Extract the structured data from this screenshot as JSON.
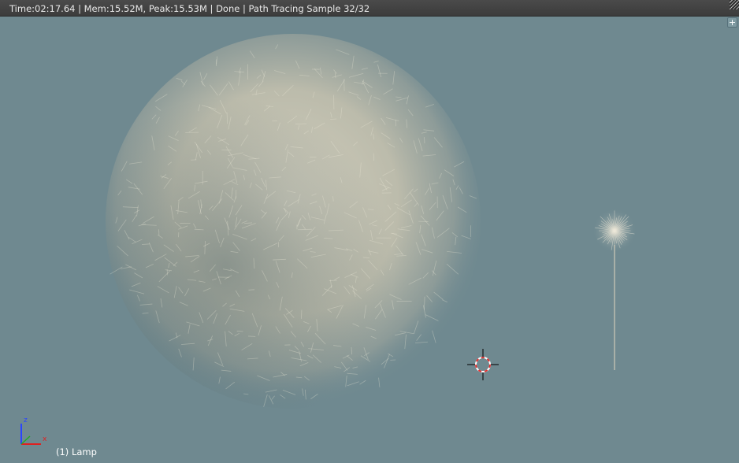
{
  "header": {
    "status_text": "Time:02:17.64 | Mem:15.52M, Peak:15.53M | Done | Path Tracing Sample 32/32"
  },
  "viewport": {
    "background_color": "#6f8990",
    "object_info": "(1) Lamp",
    "axis_labels": {
      "z": "z",
      "x": "x"
    },
    "axis_colors": {
      "z": "#2a44ff",
      "x": "#e02020",
      "y": "#22aa22"
    }
  },
  "icons": {
    "plus": "+",
    "cursor": "3d-cursor-icon"
  }
}
